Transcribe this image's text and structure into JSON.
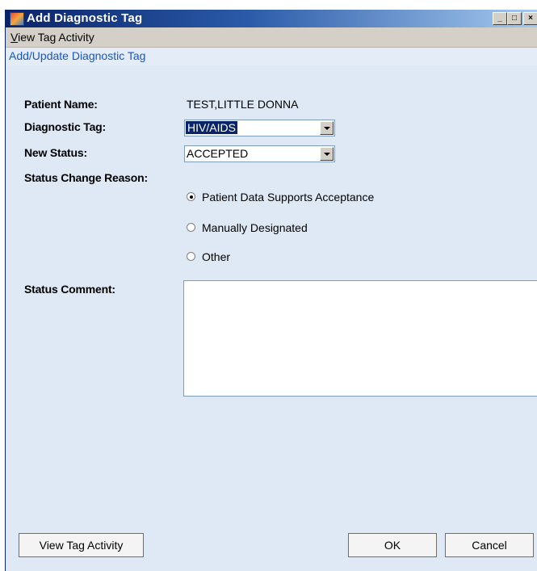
{
  "window": {
    "title": "Add Diagnostic Tag",
    "buttons": {
      "minimize": "_",
      "maximize": "□",
      "close": "×"
    }
  },
  "menu": {
    "view_tag_activity_hotkey": "V",
    "view_tag_activity_rest": "iew Tag Activity"
  },
  "group": {
    "header": "Add/Update Diagnostic Tag"
  },
  "form": {
    "patient_name_label": "Patient Name:",
    "patient_name_value": "TEST,LITTLE DONNA",
    "diagnostic_tag_label": "Diagnostic Tag:",
    "diagnostic_tag_value": "HIV/AIDS",
    "new_status_label": "New Status:",
    "new_status_value": "ACCEPTED",
    "status_change_reason_label": "Status Change Reason:",
    "reasons": [
      {
        "label": "Patient Data Supports Acceptance",
        "checked": true
      },
      {
        "label": "Manually Designated",
        "checked": false
      },
      {
        "label": "Other",
        "checked": false
      }
    ],
    "status_comment_label": "Status Comment:",
    "status_comment_value": ""
  },
  "buttons": {
    "view_tag_activity": "View Tag Activity",
    "ok": "OK",
    "cancel": "Cancel"
  },
  "colors": {
    "titlebar_start": "#0a246a",
    "titlebar_end": "#a6caf0",
    "dialog_background": "#dfe9f5",
    "group_header_text": "#1a57b8",
    "selection": "#0a246a"
  }
}
